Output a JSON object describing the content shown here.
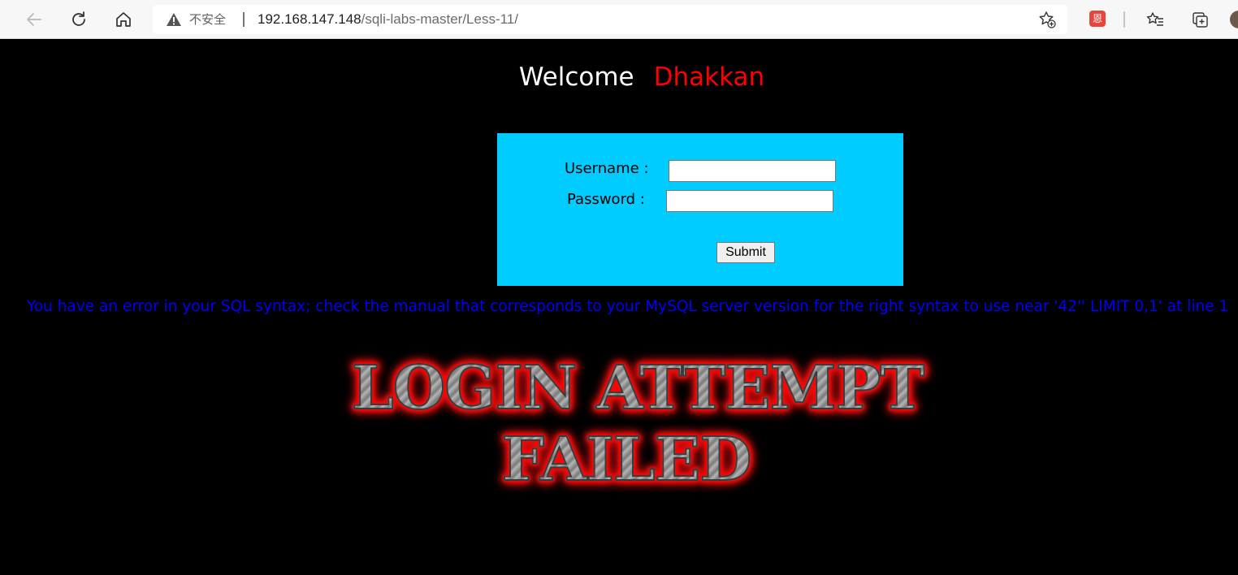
{
  "browser": {
    "security_label": "不安全",
    "url_host": "192.168.147.148",
    "url_path": "/sqli-labs-master/Less-11/",
    "extension_label": "恩",
    "icons": [
      "back-arrow-icon",
      "reload-icon",
      "home-icon",
      "warning-icon",
      "add-favorite-icon",
      "extension-icon",
      "favorites-icon",
      "collections-icon",
      "profile-avatar"
    ]
  },
  "page": {
    "welcome_text": "Welcome",
    "welcome_name": "Dhakkan",
    "form": {
      "username_label": "Username :",
      "username_value": "",
      "password_label": "Password :",
      "password_value": "",
      "submit_label": "Submit"
    },
    "error_message": "You have an error in your SQL syntax; check the manual that corresponds to your MySQL server version for the right syntax to use near '42'' LIMIT 0,1' at line 1",
    "banner_line1": "LOGIN ATTEMPT",
    "banner_line2": "FAILED"
  },
  "colors": {
    "page_background": "#000000",
    "login_box": "#00ccff",
    "welcome_name": "#ff0000",
    "error_text": "#0000ff",
    "banner_glow": "#ff0000"
  }
}
